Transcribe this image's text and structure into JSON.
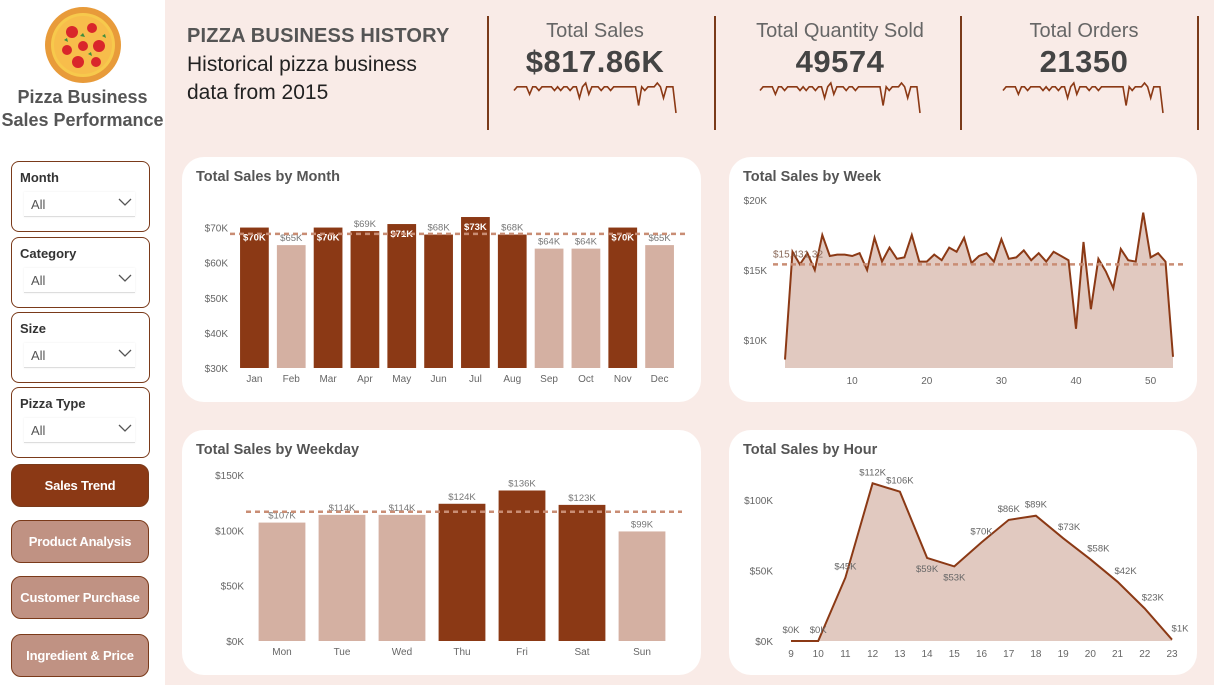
{
  "sidebar": {
    "brand_line1": "Pizza Business",
    "brand_line2": "Sales Performance",
    "slicers": [
      {
        "label": "Month",
        "value": "All"
      },
      {
        "label": "Category",
        "value": "All"
      },
      {
        "label": "Size",
        "value": "All"
      },
      {
        "label": "Pizza Type",
        "value": "All"
      }
    ],
    "nav": [
      {
        "label": "Sales Trend",
        "active": true
      },
      {
        "label": "Product Analysis",
        "active": false
      },
      {
        "label": "Customer Purchase",
        "active": false
      },
      {
        "label": "Ingredient & Price",
        "active": false
      }
    ]
  },
  "header": {
    "title": "PIZZA BUSINESS HISTORY",
    "subtitle_line1": "Historical pizza business",
    "subtitle_line2": "data from 2015"
  },
  "kpis": [
    {
      "label": "Total Sales",
      "value": "$817.86K"
    },
    {
      "label": "Total Quantity Sold",
      "value": "49574"
    },
    {
      "label": "Total Orders",
      "value": "21350"
    }
  ],
  "colors": {
    "dark": "#8b3915",
    "light": "#d4b0a2",
    "area_fill": "#e1c9c0",
    "ref_line": "#c98d74"
  },
  "chart_data": [
    {
      "type": "bar",
      "title": "Total Sales by Month",
      "categories": [
        "Jan",
        "Feb",
        "Mar",
        "Apr",
        "May",
        "Jun",
        "Jul",
        "Aug",
        "Sep",
        "Oct",
        "Nov",
        "Dec"
      ],
      "values": [
        70,
        65,
        70,
        69,
        71,
        68,
        73,
        68,
        64,
        64,
        70,
        65
      ],
      "labels": [
        "$70K",
        "$65K",
        "$70K",
        "$69K",
        "$71K",
        "$68K",
        "$73K",
        "$68K",
        "$64K",
        "$64K",
        "$70K",
        "$65K"
      ],
      "highlight": [
        true,
        false,
        true,
        true,
        true,
        true,
        true,
        true,
        false,
        false,
        true,
        false
      ],
      "label_inside": [
        true,
        false,
        true,
        false,
        true,
        false,
        true,
        false,
        false,
        false,
        true,
        false
      ],
      "yticks": [
        "$30K",
        "$40K",
        "$50K",
        "$60K",
        "$70K"
      ],
      "ytick_values": [
        30,
        40,
        50,
        60,
        70
      ],
      "ylim": [
        30,
        75
      ],
      "average": 68.2
    },
    {
      "type": "area",
      "title": "Total Sales by Week",
      "x": [
        1,
        2,
        3,
        4,
        5,
        6,
        7,
        8,
        9,
        10,
        11,
        12,
        13,
        14,
        15,
        16,
        17,
        18,
        19,
        20,
        21,
        22,
        23,
        24,
        25,
        26,
        27,
        28,
        29,
        30,
        31,
        32,
        33,
        34,
        35,
        36,
        37,
        38,
        39,
        40,
        41,
        42,
        43,
        44,
        45,
        46,
        47,
        48,
        49,
        50,
        51,
        52,
        53
      ],
      "values": [
        8.6,
        16.3,
        15.4,
        16.2,
        15.0,
        17.5,
        16.0,
        16.1,
        16.1,
        16.0,
        16.2,
        15.0,
        17.3,
        15.6,
        16.6,
        15.8,
        15.9,
        17.5,
        15.6,
        15.6,
        16.1,
        15.7,
        16.6,
        16.3,
        17.3,
        15.5,
        16.0,
        16.2,
        15.6,
        17.2,
        15.8,
        15.9,
        16.4,
        15.7,
        16.2,
        15.6,
        16.3,
        16.0,
        15.7,
        10.8,
        17.0,
        12.2,
        15.8,
        14.9,
        13.7,
        16.5,
        15.7,
        15.6,
        19.1,
        15.9,
        16.2,
        15.6,
        8.8
      ],
      "yticks": [
        "$10K",
        "$15K",
        "$20K"
      ],
      "ytick_values": [
        10,
        15,
        20
      ],
      "xticks": [
        10,
        20,
        30,
        40,
        50
      ],
      "ylim": [
        8,
        20
      ],
      "average": 15.4,
      "average_label": "$15,431.32"
    },
    {
      "type": "bar",
      "title": "Total Sales by Weekday",
      "categories": [
        "Mon",
        "Tue",
        "Wed",
        "Thu",
        "Fri",
        "Sat",
        "Sun"
      ],
      "values": [
        107,
        114,
        114,
        124,
        136,
        123,
        99
      ],
      "labels": [
        "$107K",
        "$114K",
        "$114K",
        "$124K",
        "$136K",
        "$123K",
        "$99K"
      ],
      "highlight": [
        false,
        false,
        false,
        true,
        true,
        true,
        false
      ],
      "yticks": [
        "$0K",
        "$50K",
        "$100K",
        "$150K"
      ],
      "ytick_values": [
        0,
        50,
        100,
        150
      ],
      "ylim": [
        0,
        150
      ],
      "average": 116.8
    },
    {
      "type": "area",
      "title": "Total Sales by Hour",
      "x": [
        9,
        10,
        11,
        12,
        13,
        14,
        15,
        16,
        17,
        18,
        19,
        20,
        21,
        22,
        23
      ],
      "values": [
        0,
        0,
        45,
        112,
        106,
        59,
        53,
        70,
        86,
        89,
        73,
        58,
        42,
        23,
        1
      ],
      "labels": [
        "$0K",
        "$0K",
        "$45K",
        "$112K",
        "$106K",
        "$59K",
        "$53K",
        "$70K",
        "$86K",
        "$89K",
        "$73K",
        "$58K",
        "$42K",
        "$23K",
        "$1K"
      ],
      "yticks": [
        "$0K",
        "$50K",
        "$100K"
      ],
      "ytick_values": [
        0,
        50,
        100
      ],
      "ylim": [
        0,
        120
      ]
    }
  ],
  "sparklines": {
    "sales": [
      10,
      9,
      9,
      9,
      9,
      11,
      9,
      9,
      10,
      9,
      9,
      9,
      9,
      10,
      9,
      10,
      9,
      9,
      10,
      9,
      9,
      12,
      9,
      8,
      11,
      9,
      9,
      9,
      10,
      9,
      9,
      10,
      9,
      9,
      9,
      9,
      9,
      9,
      9,
      9,
      14,
      9,
      10,
      9,
      9,
      9,
      8,
      9,
      12,
      9,
      9,
      9,
      16
    ],
    "quantity": [
      10,
      9,
      9,
      9,
      9,
      11,
      9,
      9,
      10,
      9,
      9,
      9,
      9,
      10,
      9,
      10,
      9,
      9,
      10,
      9,
      9,
      12,
      9,
      8,
      11,
      9,
      9,
      9,
      10,
      9,
      9,
      10,
      9,
      9,
      9,
      9,
      9,
      9,
      9,
      9,
      14,
      9,
      10,
      9,
      9,
      9,
      8,
      9,
      12,
      9,
      9,
      9,
      16
    ],
    "orders": [
      10,
      9,
      9,
      9,
      9,
      11,
      9,
      9,
      10,
      9,
      9,
      9,
      9,
      10,
      9,
      10,
      9,
      9,
      10,
      9,
      9,
      12,
      9,
      8,
      11,
      9,
      9,
      9,
      10,
      9,
      9,
      10,
      9,
      9,
      9,
      9,
      9,
      9,
      9,
      9,
      14,
      9,
      10,
      9,
      9,
      9,
      8,
      9,
      12,
      9,
      9,
      9,
      16
    ]
  }
}
